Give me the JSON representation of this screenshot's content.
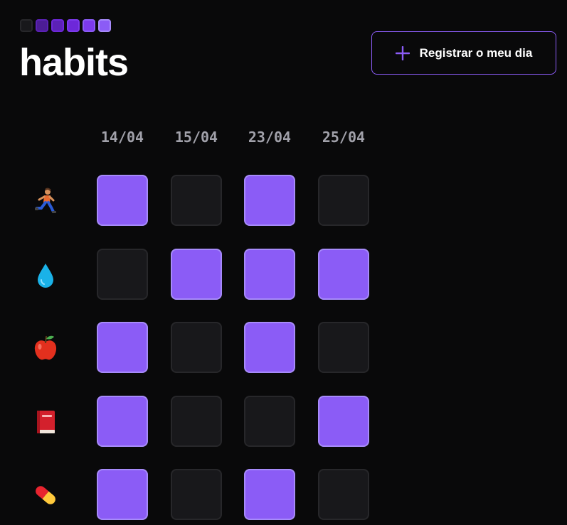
{
  "header": {
    "logo": {
      "text": "habits",
      "squares": [
        "#18181b",
        "#4c1d95",
        "#5b21b6",
        "#6d28d9",
        "#7c3aed",
        "#8b5cf6"
      ]
    },
    "new_day_button": {
      "label": "Registrar o meu dia",
      "icon": "plus-icon",
      "accent": "#8b5cf6"
    }
  },
  "summary": {
    "dates": [
      "14/04",
      "15/04",
      "23/04",
      "25/04"
    ],
    "habits": [
      {
        "icon": "person-running-icon",
        "completed": [
          true,
          false,
          true,
          false
        ]
      },
      {
        "icon": "water-drop-icon",
        "completed": [
          false,
          true,
          true,
          true
        ]
      },
      {
        "icon": "apple-icon",
        "completed": [
          true,
          false,
          true,
          false
        ]
      },
      {
        "icon": "book-icon",
        "completed": [
          true,
          false,
          false,
          true
        ]
      },
      {
        "icon": "pill-icon",
        "completed": [
          true,
          false,
          true,
          false
        ]
      }
    ]
  },
  "colors": {
    "background": "#09090a",
    "done": "#8b5cf6",
    "done_border": "#a78bfa",
    "empty": "#18181b",
    "empty_border": "#27272a",
    "date_text": "#a1a1aa"
  }
}
